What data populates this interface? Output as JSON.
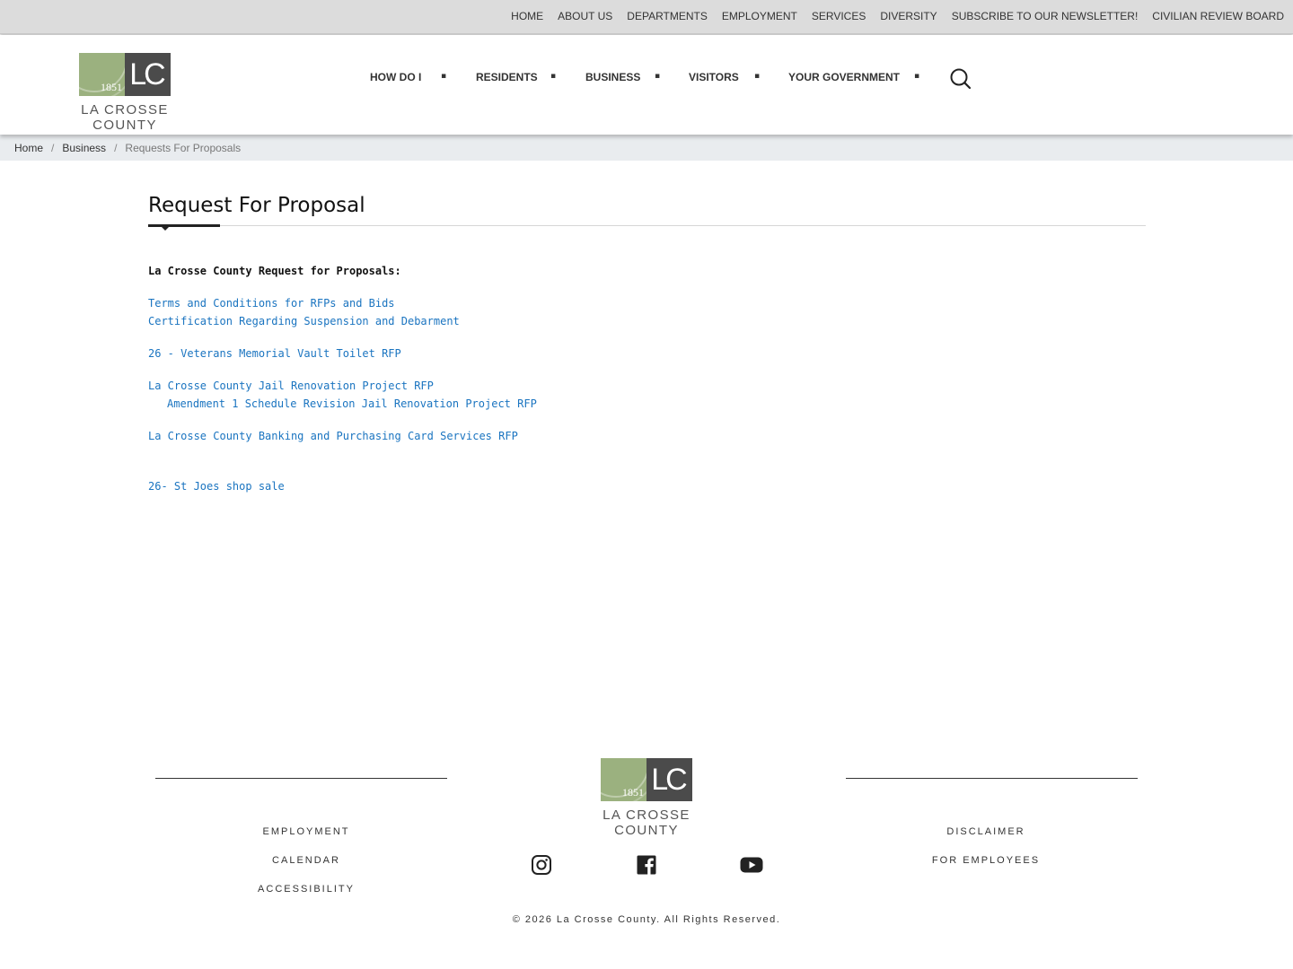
{
  "utility_nav": [
    "HOME",
    "ABOUT US",
    "DEPARTMENTS",
    "EMPLOYMENT",
    "SERVICES",
    "DIVERSITY",
    "SUBSCRIBE TO OUR NEWSLETTER!",
    "CIVILIAN REVIEW BOARD"
  ],
  "logo": {
    "year": "1851",
    "initials": "LC",
    "name": "LA CROSSE COUNTY"
  },
  "main_nav": [
    "HOW DO I",
    "RESIDENTS",
    "BUSINESS",
    "VISITORS",
    "YOUR GOVERNMENT"
  ],
  "nav_caret": "▪",
  "breadcrumb": {
    "home": "Home",
    "section": "Business",
    "current": "Requests For Proposals",
    "separator": "/"
  },
  "page": {
    "title": "Request For Proposal",
    "intro": "La Crosse County Request for Proposals:",
    "links": [
      "Terms and Conditions for RFPs and Bids",
      "Certification Regarding Suspension and Debarment",
      "26 - Veterans Memorial Vault Toilet RFP",
      "La Crosse County Jail Renovation Project RFP",
      "Amendment 1 Schedule Revision Jail Renovation Project RFP",
      "La Crosse County Banking and Purchasing Card Services RFP",
      "26- St Joes shop sale"
    ]
  },
  "footer": {
    "left_links": [
      "EMPLOYMENT",
      "CALENDAR",
      "ACCESSIBILITY"
    ],
    "right_links": [
      "DISCLAIMER",
      "FOR EMPLOYEES"
    ],
    "social": [
      "instagram-icon",
      "facebook-icon",
      "youtube-icon"
    ],
    "copyright": "© 2026 La Crosse County. All Rights Reserved."
  },
  "colors": {
    "link": "#1a74c0",
    "logo_green": "#9bb17f",
    "logo_dark": "#4b4b4b",
    "breadcrumb_bg": "#e9ecef"
  }
}
